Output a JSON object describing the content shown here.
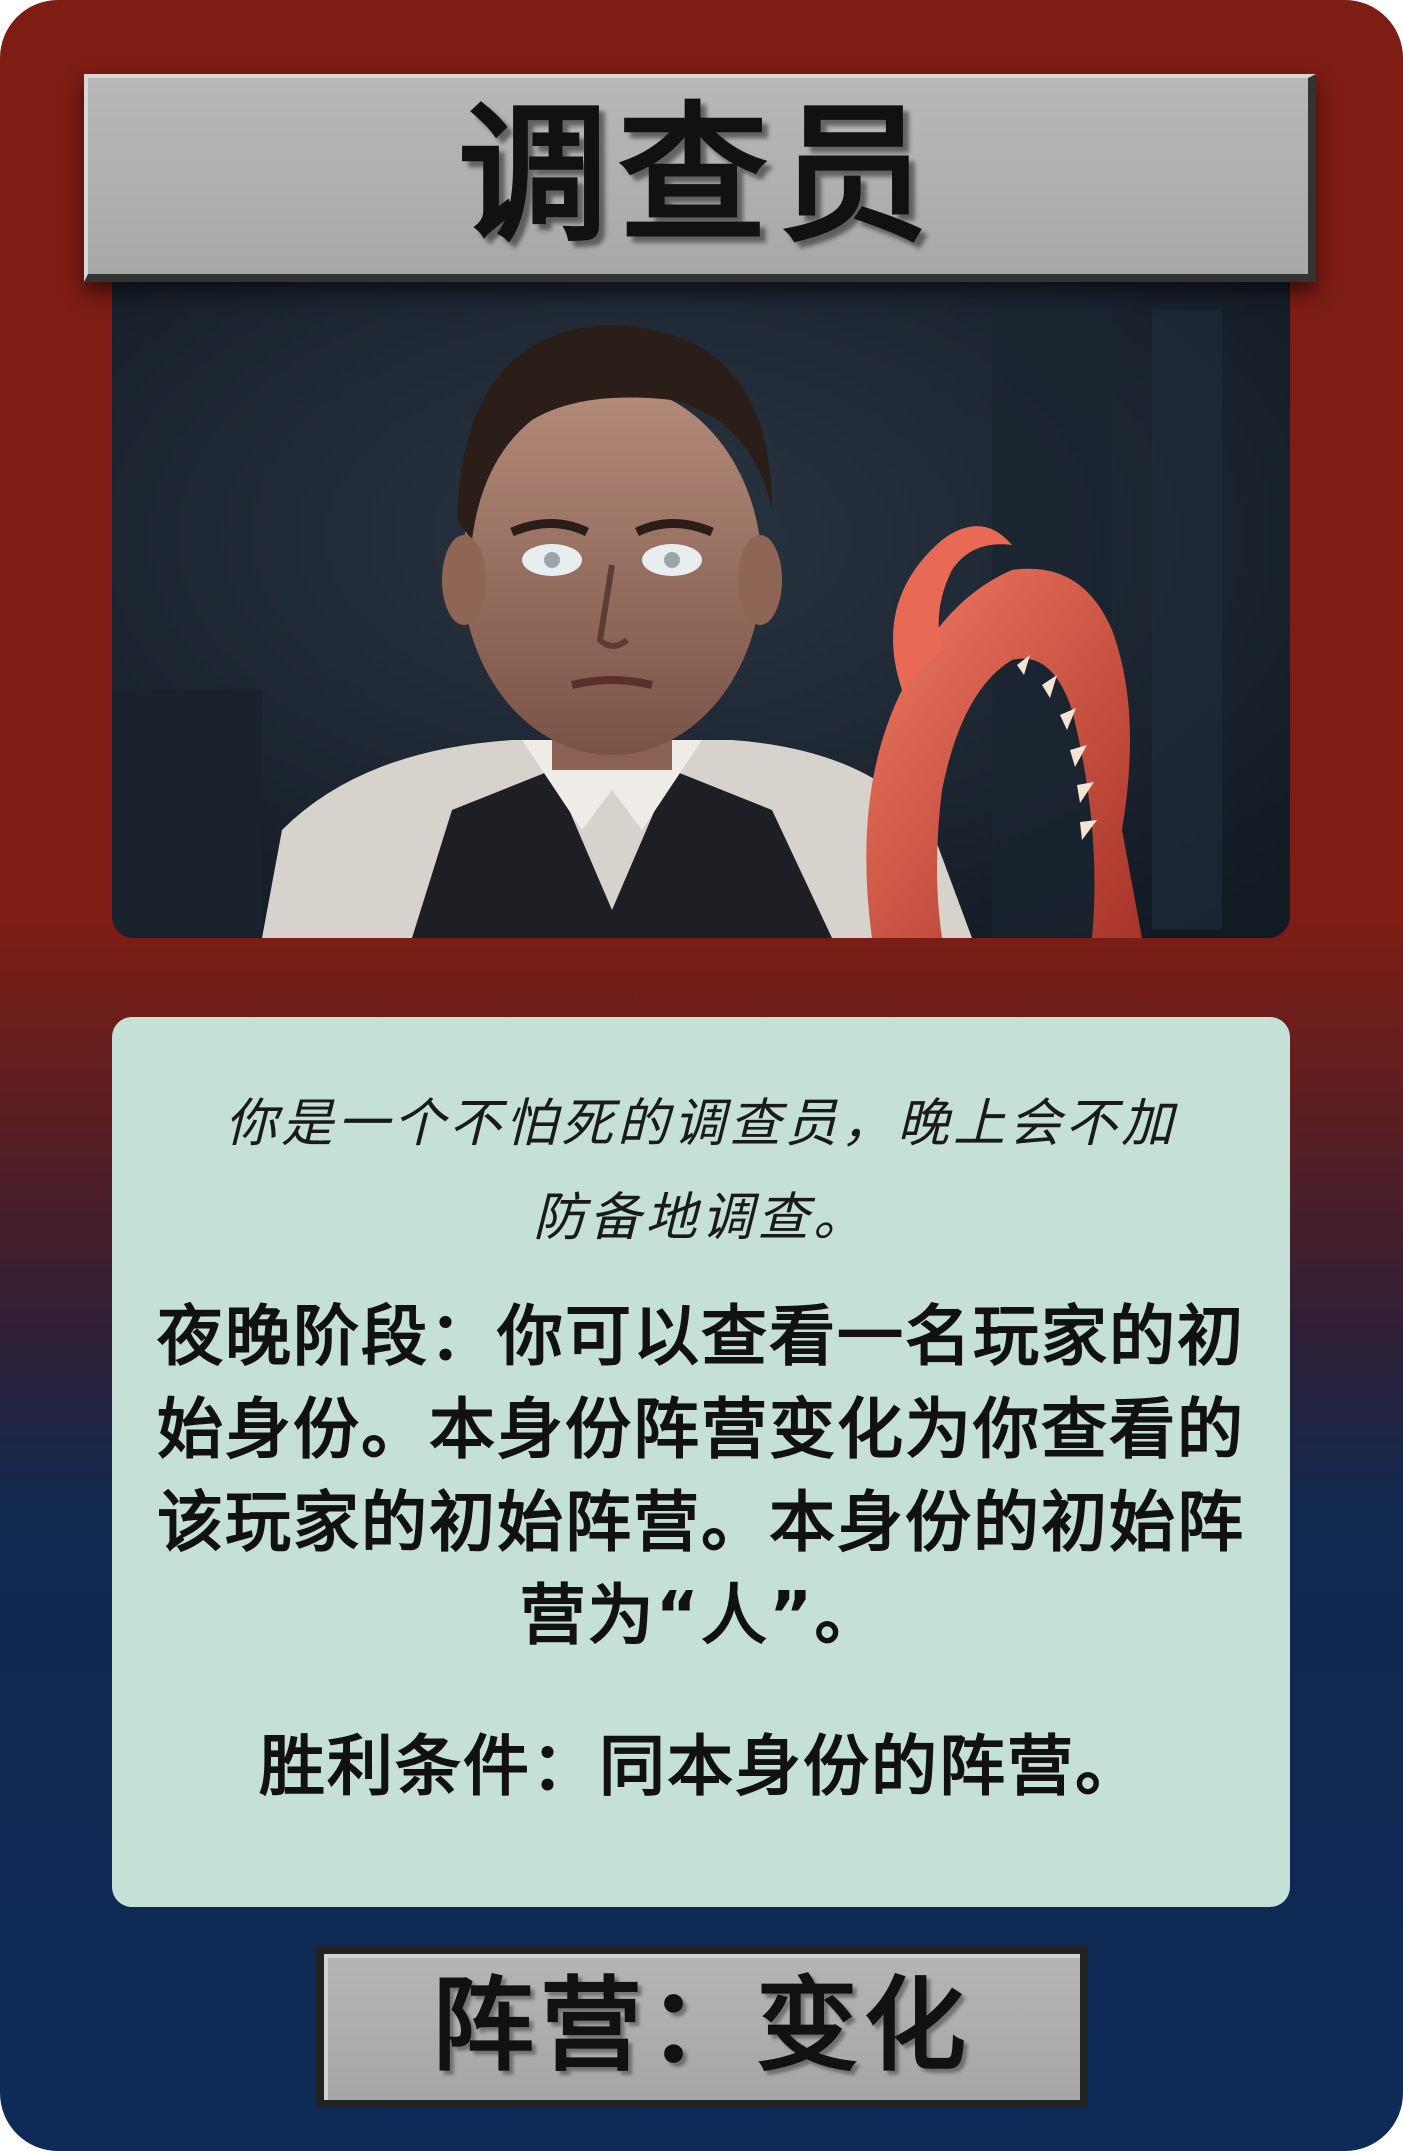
{
  "card": {
    "title": "调查员",
    "flavor_text": "你是一个不怕死的调查员，晚上会不加防备地调查。",
    "ability_text": "夜晚阶段：你可以查看一名玩家的初始身份。本身份阵营变化为你查看的该玩家的初始阵营。本身份的初始阵营为“人”。",
    "win_condition": "胜利条件：同本身份的阵营。",
    "faction": "阵营：变化"
  },
  "colors": {
    "frame_top": "#7d1d14",
    "frame_bottom": "#0e2a58",
    "title_bar": "#b0b0b0",
    "text_box": "#c5e0d7",
    "text": "#111111"
  },
  "illustration": {
    "subject": "investigator-with-tentacle",
    "icon": "character-portrait-illustration"
  }
}
